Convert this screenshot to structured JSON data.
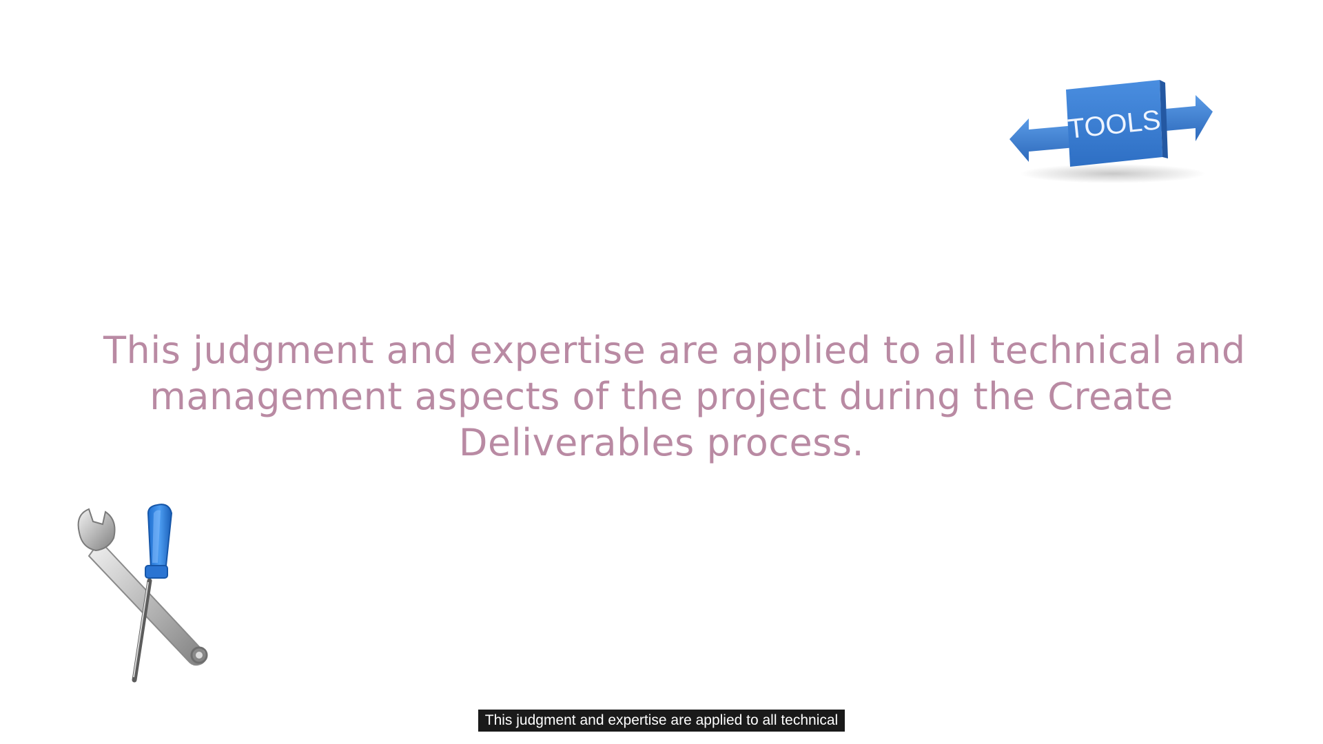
{
  "slide": {
    "tools_sign_text": "TOOLS",
    "body_lines": [
      "This judgment and expertise are applied to all technical and",
      "management aspects of the project during the Create",
      "Deliverables process."
    ],
    "text_color": "#b98aa3",
    "sign_color": "#3a7fd5",
    "icons": [
      "tools-arrow-sign-icon",
      "wrench-icon",
      "screwdriver-icon"
    ]
  },
  "caption": {
    "text": "This judgment and expertise are applied to all technical"
  }
}
